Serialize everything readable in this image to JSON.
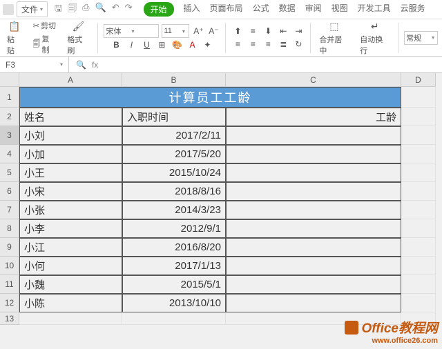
{
  "menu": {
    "file": "文件",
    "tabs": [
      "开始",
      "插入",
      "页面布局",
      "公式",
      "数据",
      "审阅",
      "视图",
      "开发工具",
      "云服务"
    ],
    "active_tab": "开始"
  },
  "ribbon": {
    "paste": "粘贴",
    "cut": "剪切",
    "copy": "复制",
    "format_painter": "格式刷",
    "font_name": "宋体",
    "font_size": "11",
    "merge": "合并居中",
    "wrap": "自动换行",
    "style": "常规"
  },
  "formula_bar": {
    "name_box": "F3",
    "fx": "fx",
    "value": ""
  },
  "columns": [
    "A",
    "B",
    "C",
    "D"
  ],
  "rows": [
    "1",
    "2",
    "3",
    "4",
    "5",
    "6",
    "7",
    "8",
    "9",
    "10",
    "11",
    "12",
    "13"
  ],
  "title": "计算员工工龄",
  "headers": {
    "name": "姓名",
    "date": "入职时间",
    "years": "工龄"
  },
  "data": [
    {
      "name": "小刘",
      "date": "2017/2/11"
    },
    {
      "name": "小加",
      "date": "2017/5/20"
    },
    {
      "name": "小王",
      "date": "2015/10/24"
    },
    {
      "name": "小宋",
      "date": "2018/8/16"
    },
    {
      "name": "小张",
      "date": "2014/3/23"
    },
    {
      "name": "小李",
      "date": "2012/9/1"
    },
    {
      "name": "小江",
      "date": "2016/8/20"
    },
    {
      "name": "小何",
      "date": "2017/1/13"
    },
    {
      "name": "小魏",
      "date": "2015/5/1"
    },
    {
      "name": "小陈",
      "date": "2013/10/10"
    }
  ],
  "watermark": {
    "title": "Office教程网",
    "url": "www.office26.com"
  }
}
